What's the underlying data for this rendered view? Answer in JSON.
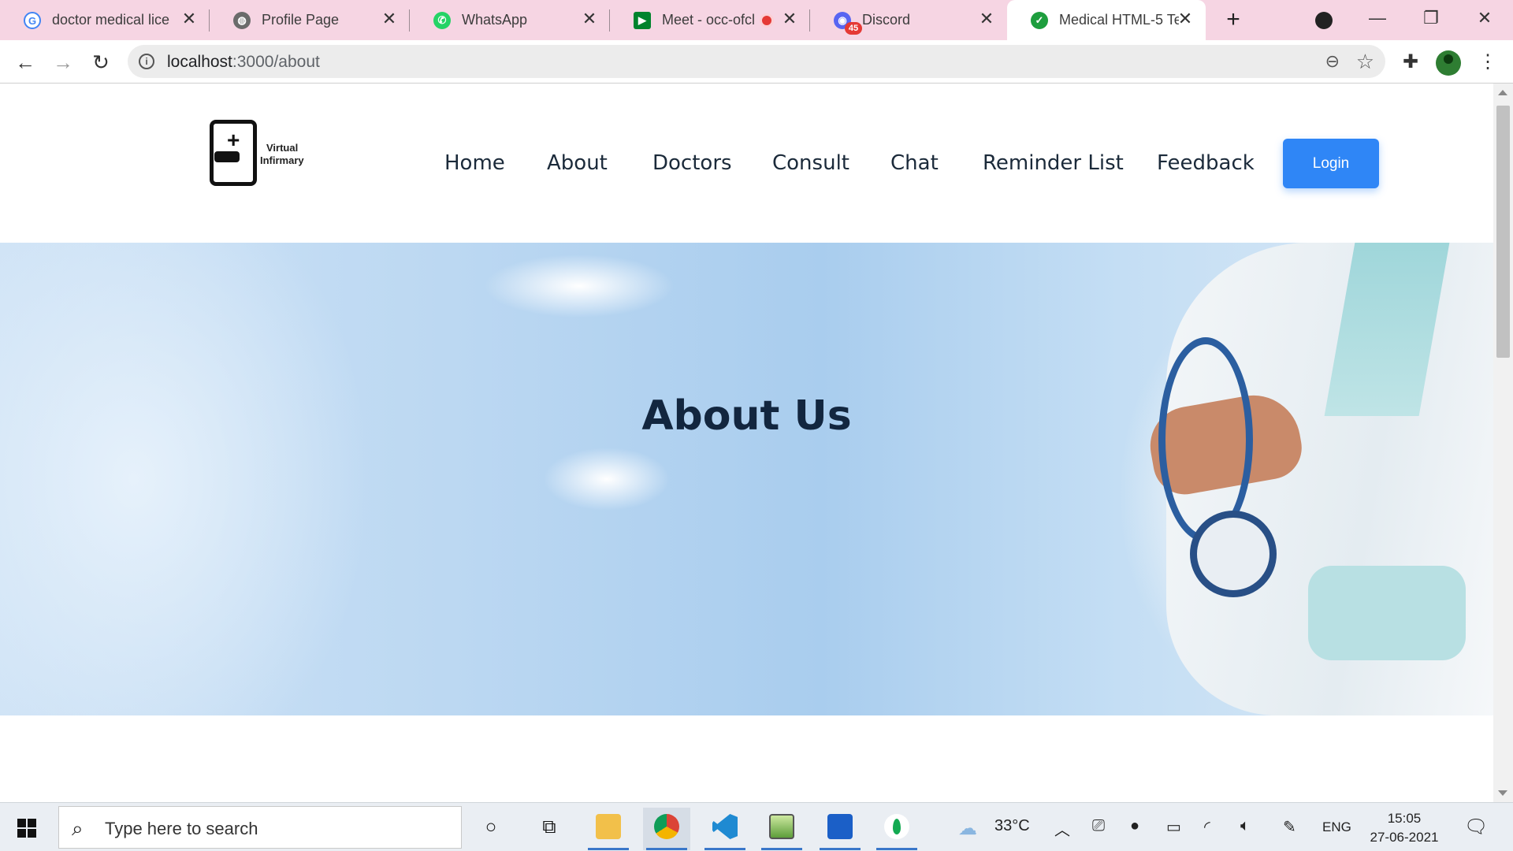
{
  "browser": {
    "tabs": [
      {
        "title": "doctor medical licen",
        "icon": "google-icon",
        "icon_color": "#4285f4",
        "active": false
      },
      {
        "title": "Profile Page",
        "icon": "globe-icon",
        "icon_color": "#6b6b6b",
        "active": false
      },
      {
        "title": "WhatsApp",
        "icon": "whatsapp-icon",
        "icon_color": "#25d366",
        "active": false
      },
      {
        "title": "Meet - occ-ofcl",
        "icon": "meet-icon",
        "icon_color": "#00832d",
        "active": false
      },
      {
        "title": "Discord",
        "icon": "discord-icon",
        "icon_color": "#5865f2",
        "badge": "45",
        "active": false
      },
      {
        "title": "Medical HTML-5 Te",
        "icon": "check-circle-icon",
        "icon_color": "#1e9e3e",
        "active": true
      }
    ],
    "new_tab_label": "+",
    "url_host": "localhost",
    "url_path": ":3000/about"
  },
  "site": {
    "logo_line1": "Virtual",
    "logo_line2": "Infirmary",
    "nav": [
      "Home",
      "About",
      "Doctors",
      "Consult",
      "Chat",
      "Reminder List",
      "Feedback"
    ],
    "login_label": "Login",
    "hero_title": "About Us",
    "accent_color": "#2f86f6",
    "heading_color": "#12263f"
  },
  "taskbar": {
    "search_placeholder": "Type here to search",
    "weather": "33°C",
    "language": "ENG",
    "time": "15:05",
    "date": "27-06-2021"
  }
}
